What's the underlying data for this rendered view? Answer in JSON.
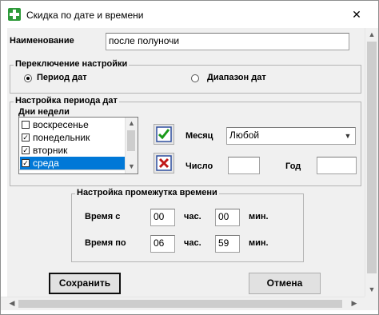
{
  "window": {
    "title": "Скидка по дате и времени",
    "close_glyph": "✕"
  },
  "name": {
    "label": "Наименование",
    "value": "после полуночи"
  },
  "switch_group": {
    "title": "Переключение настройки",
    "options": [
      {
        "label": "Период дат",
        "selected": true
      },
      {
        "label": "Диапазон дат",
        "selected": false
      }
    ]
  },
  "period_group": {
    "title": "Настройка периода дат",
    "weekdays": {
      "title": "Дни недели",
      "items": [
        {
          "label": "воскресенье",
          "checked": false,
          "selected": false
        },
        {
          "label": "понедельник",
          "checked": true,
          "selected": false
        },
        {
          "label": "вторник",
          "checked": true,
          "selected": false
        },
        {
          "label": "среда",
          "checked": true,
          "selected": true
        }
      ],
      "check_mark": "✓"
    },
    "month": {
      "label": "Месяц",
      "value": "Любой"
    },
    "day": {
      "label": "Число",
      "value": ""
    },
    "year": {
      "label": "Год",
      "value": ""
    }
  },
  "time_group": {
    "title": "Настройка промежутка времени",
    "from": {
      "label": "Время с",
      "hours": "00",
      "hours_unit": "час.",
      "minutes": "00",
      "minutes_unit": "мин."
    },
    "to": {
      "label": "Время по",
      "hours": "06",
      "hours_unit": "час.",
      "minutes": "59",
      "minutes_unit": "мин."
    }
  },
  "buttons": {
    "save": "Сохранить",
    "cancel": "Отмена"
  },
  "scroll_glyphs": {
    "up": "▲",
    "down": "▼",
    "left": "◀",
    "right": "▶"
  }
}
